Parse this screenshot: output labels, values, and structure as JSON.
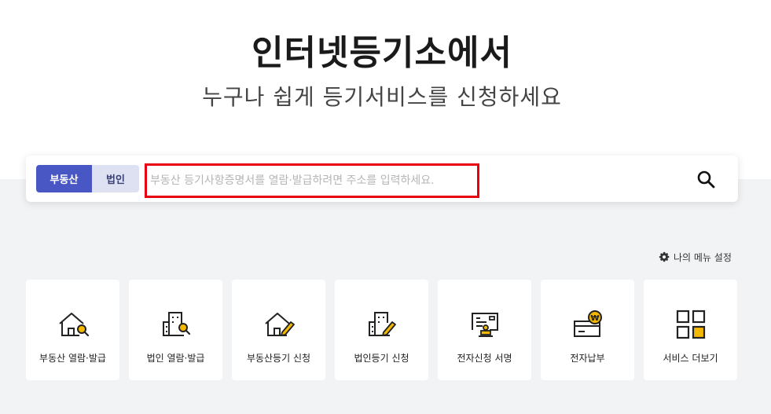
{
  "hero": {
    "title": "인터넷등기소에서",
    "subtitle": "누구나 쉽게 등기서비스를 신청하세요"
  },
  "search": {
    "tabs": [
      {
        "label": "부동산",
        "active": true
      },
      {
        "label": "법인",
        "active": false
      }
    ],
    "value": "",
    "placeholder": "부동산 등기사항증명서를 열람·발급하려면 주소를 입력하세요.",
    "button_icon": "search-icon"
  },
  "settings": {
    "label": "나의 메뉴 설정",
    "icon": "gear-icon"
  },
  "cards": [
    {
      "label": "부동산 열람·발급",
      "icon": "house-search-icon"
    },
    {
      "label": "법인 열람·발급",
      "icon": "building-search-icon"
    },
    {
      "label": "부동산등기 신청",
      "icon": "house-pen-icon"
    },
    {
      "label": "법인등기 신청",
      "icon": "building-pen-icon"
    },
    {
      "label": "전자신청 서명",
      "icon": "document-stamp-icon"
    },
    {
      "label": "전자납부",
      "icon": "won-payment-icon"
    },
    {
      "label": "서비스 더보기",
      "icon": "grid-more-icon"
    }
  ],
  "colors": {
    "accent": "#4957c4",
    "tab_inactive_bg": "#dde1f2",
    "highlight_border": "#e60012",
    "icon_yellow": "#f5b800",
    "section_bg": "#f2f3f5"
  }
}
